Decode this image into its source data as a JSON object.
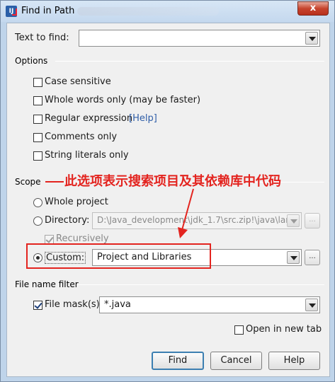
{
  "window": {
    "title": "Find in Path",
    "close_label": "x"
  },
  "text_to_find": {
    "label": "Text to find:",
    "value": ""
  },
  "options": {
    "header": "Options",
    "items": [
      {
        "label": "Case sensitive",
        "checked": false
      },
      {
        "label": "Whole words only (may be faster)",
        "checked": false
      },
      {
        "label": "Regular expression",
        "checked": false,
        "help": "[Help]"
      },
      {
        "label": "Comments only",
        "checked": false
      },
      {
        "label": "String literals only",
        "checked": false
      }
    ]
  },
  "scope": {
    "header": "Scope",
    "whole_project": "Whole project",
    "directory": {
      "label": "Directory:",
      "value": "D:\\Java_development\\jdk_1.7\\src.zip!\\java\\lan",
      "browse": "..."
    },
    "recursively": "Recursively",
    "custom": {
      "label": "Custom:",
      "value": "Project and Libraries",
      "browse": "..."
    },
    "selected": "custom"
  },
  "annotation": {
    "text": "此选项表示搜索项目及其依赖库中代码",
    "color": "#e3241f"
  },
  "file_filter": {
    "header": "File name filter",
    "file_mask_label": "File mask(s)",
    "file_mask_checked": true,
    "file_mask_value": "*.java"
  },
  "open_in_new_tab": {
    "label": "Open in new tab",
    "checked": false
  },
  "buttons": {
    "find": "Find",
    "cancel": "Cancel",
    "help": "Help"
  }
}
